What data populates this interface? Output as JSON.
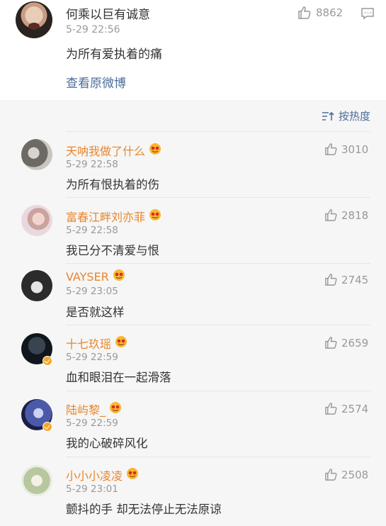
{
  "post": {
    "author": "何乘以巨有诚意",
    "time": "5-29 22:56",
    "text": "为所有爱执着的痛",
    "view_original": "查看原微博",
    "likes": "8862",
    "avatar_icon": "avatar-shouting-man",
    "like_icon": "thumbs-up-icon",
    "comment_icon": "comment-bubble-icon"
  },
  "sort": {
    "label": "按热度",
    "icon": "sort-icon"
  },
  "comments": [
    {
      "name": "天呐我做了什么",
      "time": "5-29 22:58",
      "text": "为所有恨执着的伤",
      "likes": "3010"
    },
    {
      "name": "富春江畔刘亦菲",
      "time": "5-29 22:58",
      "text": "我已分不清爱与恨",
      "likes": "2818"
    },
    {
      "name": "VAYSER",
      "time": "5-29 23:05",
      "text": "是否就这样",
      "likes": "2745"
    },
    {
      "name": "十七玖瑶",
      "time": "5-29 22:59",
      "text": "血和眼泪在一起滑落",
      "likes": "2659"
    },
    {
      "name": "陆屿黎_",
      "time": "5-29 22:59",
      "text": "我的心破碎风化",
      "likes": "2574"
    },
    {
      "name": "小小小凌凌",
      "time": "5-29 23:01",
      "text": "颤抖的手 却无法停止无法原谅",
      "likes": "2508"
    }
  ],
  "colors": {
    "accent_link": "#4a6e99",
    "username": "#e8862e",
    "muted": "#999999"
  }
}
